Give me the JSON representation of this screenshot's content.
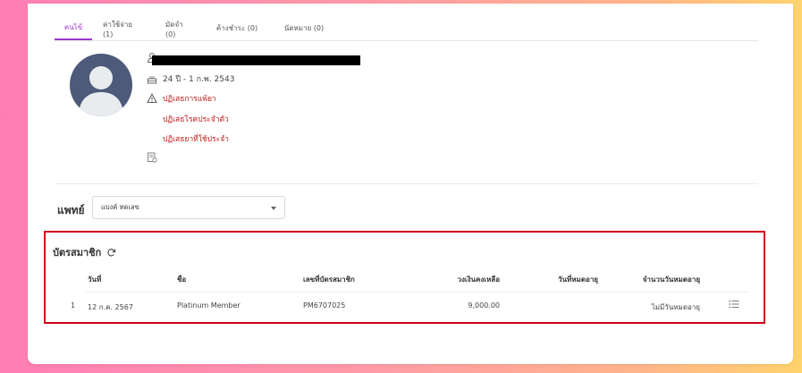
{
  "tabs": [
    {
      "label": "คนไข้",
      "active": true
    },
    {
      "label": "ค่าใช้จ่าย (1)",
      "active": false
    },
    {
      "label": "มัดจำ (0)",
      "active": false
    },
    {
      "label": "ค้างชำระ (0)",
      "active": false
    },
    {
      "label": "นัดหมาย (0)",
      "active": false
    }
  ],
  "patient": {
    "age_birth": "24 ปี - 1 ก.พ. 2543",
    "allergy_drug": "ปฏิเสธการแพ้ยา",
    "allergy_chronic": "ปฏิเสธโรคประจำตัว",
    "allergy_regular_med": "ปฏิเสธยาที่ใช้ประจำ"
  },
  "doctor": {
    "label": "แพทย์",
    "selected": "แบงค์ ทดเลข"
  },
  "membership": {
    "title": "บัตรสมาชิก",
    "columns": [
      "วันที่",
      "ชื่อ",
      "เลขที่บัตรสมาชิก",
      "วงเงินคงเหลือ",
      "วันที่หมดอายุ",
      "จำนวนวันหมดอายุ"
    ],
    "rows": [
      {
        "index": "1",
        "date": "12 ก.ค. 2567",
        "name": "Platinum Member",
        "card_no": "PM6707025",
        "balance": "9,000.00",
        "expiry": "",
        "days_left": "ไม่มีวันหมดอายุ"
      }
    ]
  }
}
